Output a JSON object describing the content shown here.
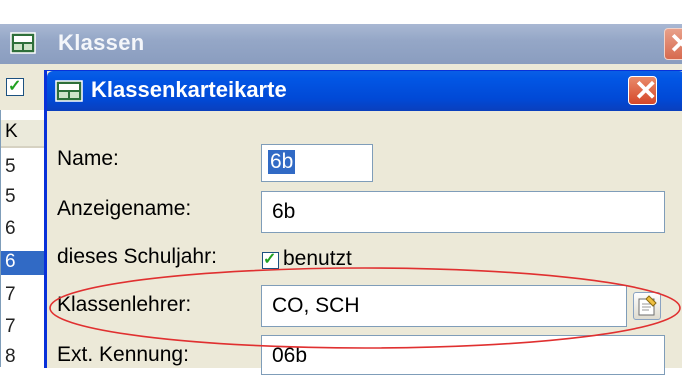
{
  "background_window": {
    "title": "Klassen",
    "list_header": "K",
    "rows": [
      "5",
      "5",
      "6",
      "6",
      "7",
      "7",
      "8"
    ],
    "selected_row_index": 3
  },
  "dialog": {
    "title": "Klassenkarteikarte",
    "fields": {
      "name": {
        "label": "Name:",
        "value": "6b"
      },
      "display_name": {
        "label": "Anzeigename:",
        "value": "6b"
      },
      "school_year": {
        "label": "dieses Schuljahr:",
        "checkbox_label": "benutzt",
        "checked": true
      },
      "class_teacher": {
        "label": "Klassenlehrer:",
        "value": "CO, SCH"
      },
      "ext_id": {
        "label": "Ext. Kennung:",
        "value": "06b"
      }
    }
  },
  "icons": {
    "app": "school-app-icon",
    "close": "close-icon",
    "picker": "teacher-picker-icon",
    "check": "checkmark-icon"
  },
  "colors": {
    "dialog_title_bar": "#0256e4",
    "selection": "#316ac5",
    "highlight_ellipse": "#e03030",
    "check": "#21a121"
  }
}
